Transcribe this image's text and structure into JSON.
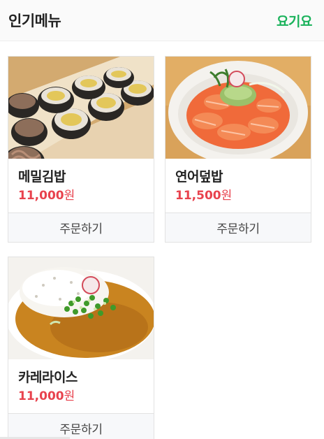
{
  "header": {
    "title": "인기메뉴",
    "brand": "요기요",
    "brand_color": "#19b25a"
  },
  "menu": [
    {
      "name": "메밀김밥",
      "price": "11,000",
      "currency": "원",
      "order_label": "주문하기"
    },
    {
      "name": "연어덮밥",
      "price": "11,500",
      "currency": "원",
      "order_label": "주문하기"
    },
    {
      "name": "카레라이스",
      "price": "11,000",
      "currency": "원",
      "order_label": "주문하기"
    }
  ],
  "colors": {
    "price": "#e8424d",
    "order_bg": "#f7f8fa"
  }
}
